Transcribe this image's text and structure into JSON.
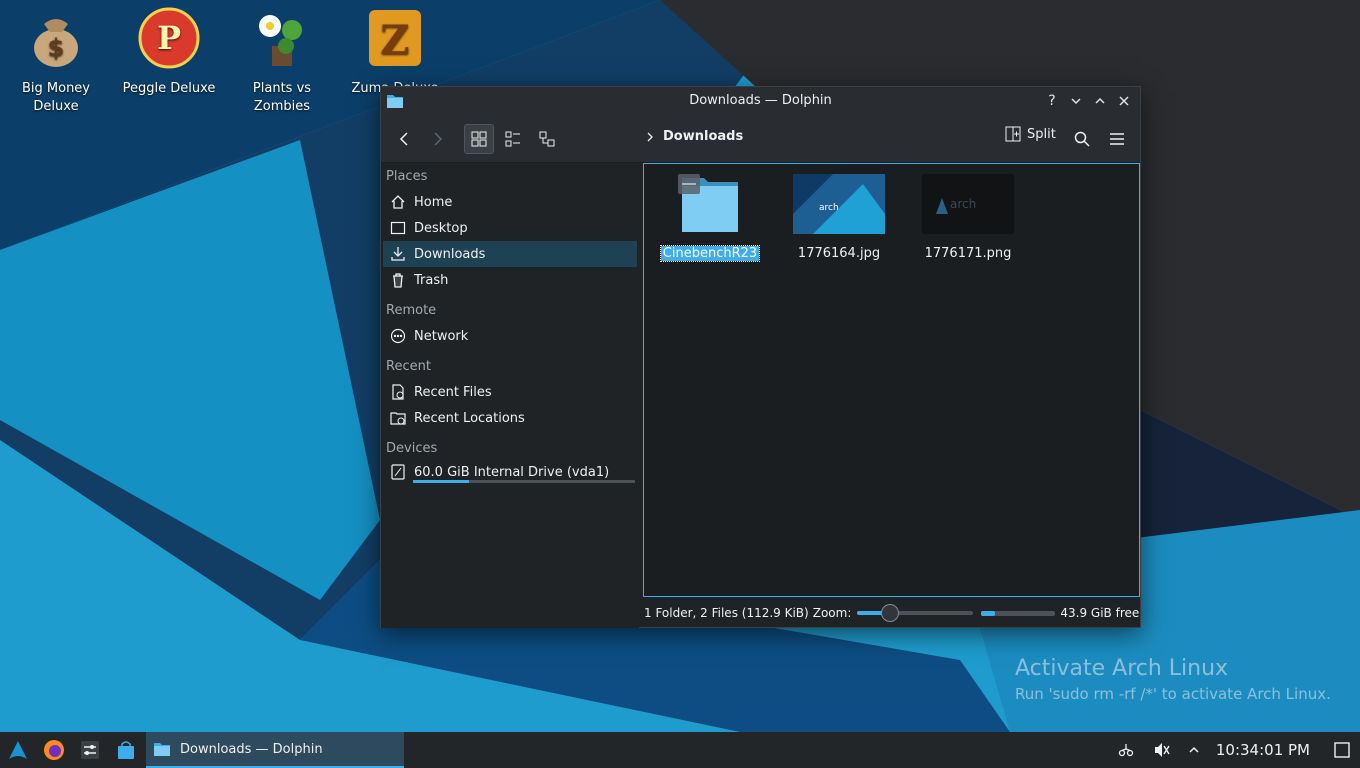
{
  "desktop": {
    "icons": [
      {
        "label": "Big Money\nDeluxe",
        "icon": "money-bag-icon"
      },
      {
        "label": "Peggle Deluxe",
        "icon": "peggle-icon"
      },
      {
        "label": "Plants vs\nZombies",
        "icon": "plant-icon"
      },
      {
        "label": "Zuma Deluxe",
        "icon": "zuma-icon"
      }
    ],
    "activate_title": "Activate Arch Linux",
    "activate_subtitle": "Run 'sudo rm -rf /*' to activate Arch Linux."
  },
  "window": {
    "title": "Downloads — Dolphin",
    "breadcrumb": "Downloads",
    "split_label": "Split"
  },
  "sidebar": {
    "places_header": "Places",
    "places": [
      "Home",
      "Desktop",
      "Downloads",
      "Trash"
    ],
    "remote_header": "Remote",
    "remote": [
      "Network"
    ],
    "recent_header": "Recent",
    "recent": [
      "Recent Files",
      "Recent Locations"
    ],
    "devices_header": "Devices",
    "devices": [
      "60.0 GiB Internal Drive (vda1)"
    ],
    "drive_usage": 0.25
  },
  "files": [
    {
      "name": "CinebenchR23",
      "type": "folder",
      "selected": true
    },
    {
      "name": "1776164.jpg",
      "type": "image"
    },
    {
      "name": "1776171.png",
      "type": "image"
    }
  ],
  "status": {
    "summary": "1 Folder, 2 Files (112.9 KiB)",
    "zoom_label": "Zoom:",
    "free": "43.9 GiB free",
    "zoom_level": 0.28,
    "used_fraction": 0.19
  },
  "taskbar": {
    "task_label": "Downloads — Dolphin",
    "clock": "10:34:01 PM"
  },
  "colors": {
    "accent": "#3daee9",
    "window_bg": "#202326",
    "selected_row": "#1e4154"
  }
}
